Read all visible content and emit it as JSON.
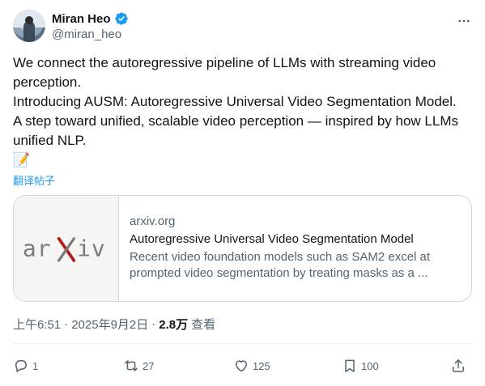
{
  "author": {
    "display_name": "Miran Heo",
    "handle": "@miran_heo",
    "verified": true
  },
  "icons": {
    "verified": "verified-badge-icon",
    "more": "more-horizontal-icon",
    "reply": "reply-icon",
    "retweet": "retweet-icon",
    "like": "heart-icon",
    "bookmark": "bookmark-icon",
    "share": "share-icon"
  },
  "colors": {
    "accent": "#1d9bf0",
    "text": "#0f1419",
    "muted": "#536471",
    "border": "#cfd9de",
    "arxiv_red": "#b31b1b",
    "arxiv_gray": "#7b7b7b"
  },
  "tweet": {
    "line1": "We connect the autoregressive pipeline of LLMs with streaming video perception.",
    "line2": "Introducing AUSM: Autoregressive Universal Video Segmentation Model.",
    "line3": "A step toward unified, scalable video perception — inspired by how LLMs unified NLP.",
    "emoji": "📝",
    "translate_label": "翻译帖子"
  },
  "card": {
    "logo_text": "arXiv",
    "domain": "arxiv.org",
    "title": "Autoregressive Universal Video Segmentation Model",
    "description": "Recent video foundation models such as SAM2 excel at prompted video segmentation by treating masks as a ..."
  },
  "meta": {
    "time": "上午6:51",
    "sep1": "·",
    "date": "2025年9月2日",
    "sep2": "·",
    "views": "2.8万",
    "views_label": "查看"
  },
  "actions": {
    "replies": "1",
    "retweets": "27",
    "likes": "125",
    "bookmarks": "100"
  }
}
